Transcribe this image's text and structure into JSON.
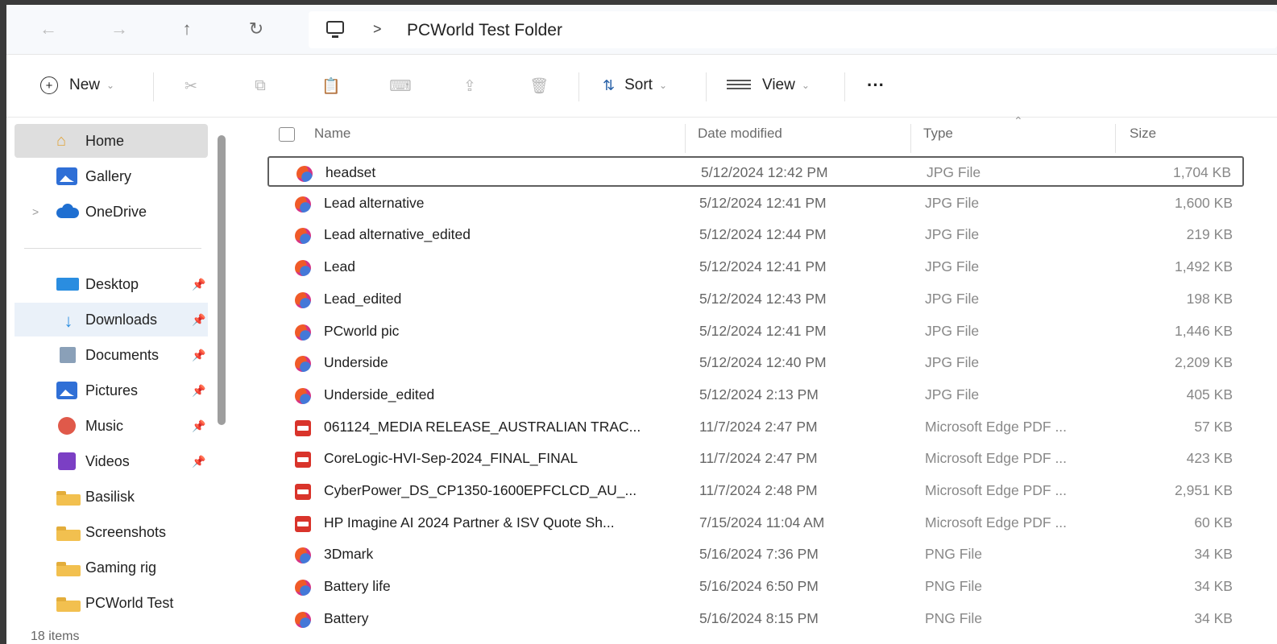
{
  "address_bar": {
    "back_icon": "arrow-left-icon",
    "forward_icon": "arrow-right-icon",
    "up_icon": "arrow-up-icon",
    "refresh_icon": "refresh-icon",
    "pc_icon": "monitor-icon",
    "separator": ">",
    "current_folder": "PCWorld Test Folder"
  },
  "toolbar": {
    "new_label": "New",
    "sort_label": "Sort",
    "view_label": "View",
    "more_label": "···",
    "icons": [
      "cut-icon",
      "copy-icon",
      "paste-icon",
      "rename-icon",
      "share-icon",
      "delete-icon"
    ]
  },
  "sidebar": {
    "items": [
      {
        "label": "Home",
        "icon": "home-icon"
      },
      {
        "label": "Gallery",
        "icon": "gallery-icon"
      },
      {
        "label": "OneDrive",
        "icon": "cloud-icon",
        "expand": ">"
      },
      {
        "label": "Desktop",
        "icon": "desktop-icon",
        "pin": "📌"
      },
      {
        "label": "Downloads",
        "icon": "download-icon",
        "pin": "📌"
      },
      {
        "label": "Documents",
        "icon": "documents-icon",
        "pin": "📌"
      },
      {
        "label": "Pictures",
        "icon": "pictures-icon",
        "pin": "📌"
      },
      {
        "label": "Music",
        "icon": "music-icon",
        "pin": "📌"
      },
      {
        "label": "Videos",
        "icon": "videos-icon",
        "pin": "📌"
      },
      {
        "label": "Basilisk",
        "icon": "folder-icon"
      },
      {
        "label": "Screenshots",
        "icon": "folder-icon"
      },
      {
        "label": "Gaming rig",
        "icon": "folder-icon"
      },
      {
        "label": "PCWorld Test",
        "icon": "folder-icon"
      }
    ],
    "item_count": "18 items"
  },
  "columns": {
    "name": "Name",
    "date": "Date modified",
    "type": "Type",
    "size": "Size"
  },
  "files": [
    {
      "name": "headset",
      "date": "5/12/2024 12:42 PM",
      "type": "JPG File",
      "size": "1,704 KB",
      "kind": "image"
    },
    {
      "name": "Lead alternative",
      "date": "5/12/2024 12:41 PM",
      "type": "JPG File",
      "size": "1,600 KB",
      "kind": "image"
    },
    {
      "name": "Lead alternative_edited",
      "date": "5/12/2024 12:44 PM",
      "type": "JPG File",
      "size": "219 KB",
      "kind": "image"
    },
    {
      "name": "Lead",
      "date": "5/12/2024 12:41 PM",
      "type": "JPG File",
      "size": "1,492 KB",
      "kind": "image"
    },
    {
      "name": "Lead_edited",
      "date": "5/12/2024 12:43 PM",
      "type": "JPG File",
      "size": "198 KB",
      "kind": "image"
    },
    {
      "name": "PCworld pic",
      "date": "5/12/2024 12:41 PM",
      "type": "JPG File",
      "size": "1,446 KB",
      "kind": "image"
    },
    {
      "name": "Underside",
      "date": "5/12/2024 12:40 PM",
      "type": "JPG File",
      "size": "2,209 KB",
      "kind": "image"
    },
    {
      "name": "Underside_edited",
      "date": "5/12/2024 2:13 PM",
      "type": "JPG File",
      "size": "405 KB",
      "kind": "image"
    },
    {
      "name": "061124_MEDIA RELEASE_AUSTRALIAN TRAC...",
      "date": "11/7/2024 2:47 PM",
      "type": "Microsoft Edge PDF ...",
      "size": "57 KB",
      "kind": "pdf"
    },
    {
      "name": "CoreLogic-HVI-Sep-2024_FINAL_FINAL",
      "date": "11/7/2024 2:47 PM",
      "type": "Microsoft Edge PDF ...",
      "size": "423 KB",
      "kind": "pdf"
    },
    {
      "name": "CyberPower_DS_CP1350-1600EPFCLCD_AU_...",
      "date": "11/7/2024 2:48 PM",
      "type": "Microsoft Edge PDF ...",
      "size": "2,951 KB",
      "kind": "pdf"
    },
    {
      "name": "HP Imagine AI 2024 Partner & ISV Quote Sh...",
      "date": "7/15/2024 11:04 AM",
      "type": "Microsoft Edge PDF ...",
      "size": "60 KB",
      "kind": "pdf"
    },
    {
      "name": "3Dmark",
      "date": "5/16/2024 7:36 PM",
      "type": "PNG File",
      "size": "34 KB",
      "kind": "image"
    },
    {
      "name": "Battery life",
      "date": "5/16/2024 6:50 PM",
      "type": "PNG File",
      "size": "34 KB",
      "kind": "image"
    },
    {
      "name": "Battery",
      "date": "5/16/2024 8:15 PM",
      "type": "PNG File",
      "size": "34 KB",
      "kind": "image"
    }
  ]
}
